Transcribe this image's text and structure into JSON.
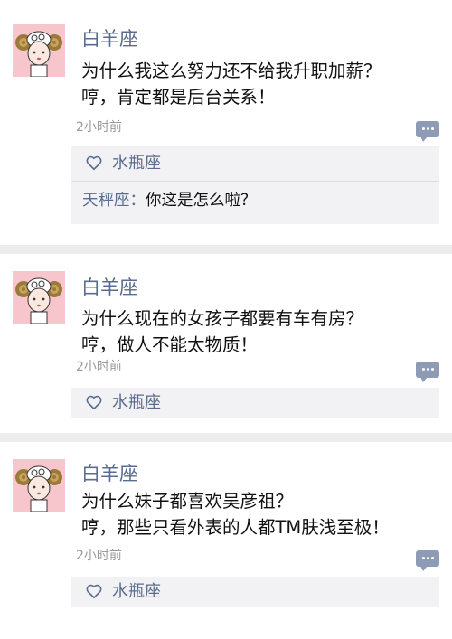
{
  "posts": [
    {
      "username": "白羊座",
      "lines": [
        "为什么我这么努力还不给我升职加薪？",
        "哼，肯定都是后台关系！"
      ],
      "time": "2小时前",
      "likes": "水瓶座",
      "comment": {
        "name": "天秤座",
        "colon": "：",
        "text": "你这是怎么啦？"
      }
    },
    {
      "username": "白羊座",
      "lines": [
        "为什么现在的女孩子都要有车有房？",
        "哼，做人不能太物质！"
      ],
      "time": "2小时前",
      "likes": "水瓶座"
    },
    {
      "username": "白羊座",
      "lines": [
        "为什么妹子都喜欢吴彦祖？",
        "哼，那些只看外表的人都TM肤浅至极！"
      ],
      "time": "2小时前",
      "likes": "水瓶座"
    }
  ],
  "icons": {
    "avatar": "aries-ram-avatar",
    "heart": "heart-outline-icon",
    "comment": "comment-bubble-icon"
  },
  "colors": {
    "username": "#5a6c8f",
    "avatar_bg": "#f7c6cc",
    "comment_button": "#8e9bb5",
    "likes_bg": "#f2f2f4",
    "page_bg": "#ececec"
  }
}
